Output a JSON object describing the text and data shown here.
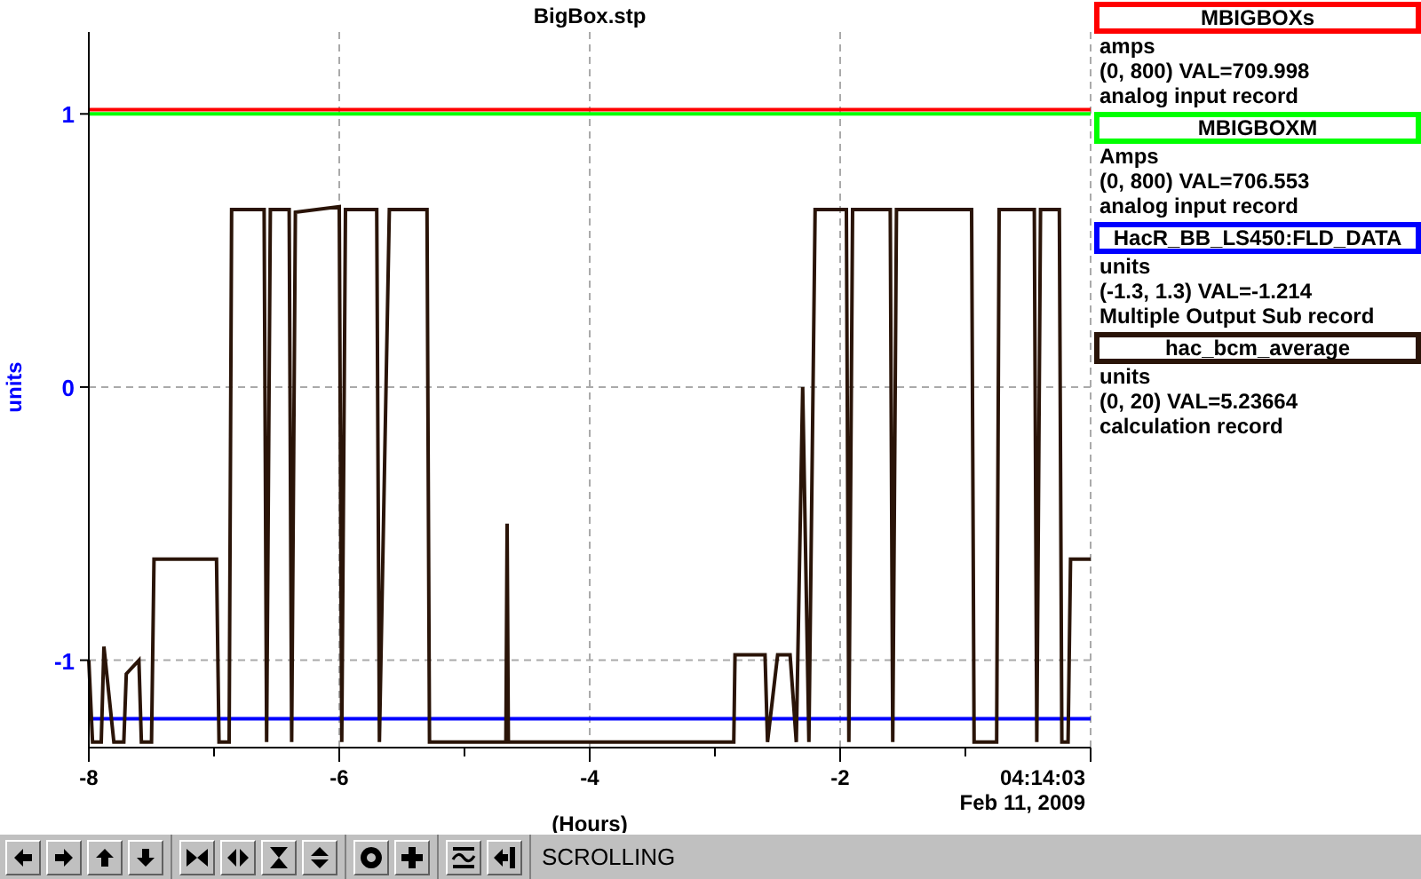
{
  "plot": {
    "time": "04:14:03",
    "date": "Feb 11, 2009",
    "chart_data": {
      "type": "line",
      "title": "BigBox.stp",
      "xlabel": "(Hours)",
      "ylabel": "units",
      "xlim": [
        -8,
        0
      ],
      "ylim": [
        -1.32,
        1.3
      ],
      "grid": true,
      "xticks": [
        -8,
        -6,
        -4,
        -2
      ],
      "yticks": [
        -1,
        0,
        1
      ],
      "x": [
        -8.0,
        -7.97,
        -7.9,
        -7.88,
        -7.8,
        -7.72,
        -7.7,
        -7.6,
        -7.58,
        -7.5,
        -7.48,
        -6.98,
        -6.96,
        -6.88,
        -6.86,
        -6.6,
        -6.58,
        -6.55,
        -6.4,
        -6.38,
        -6.35,
        -6.0,
        -5.98,
        -5.95,
        -5.7,
        -5.68,
        -5.6,
        -5.3,
        -5.28,
        -4.67,
        -4.66,
        -4.65,
        -2.85,
        -2.84,
        -2.6,
        -2.58,
        -2.5,
        -2.4,
        -2.35,
        -2.3,
        -2.25,
        -2.2,
        -1.95,
        -1.93,
        -1.9,
        -1.6,
        -1.58,
        -1.55,
        -0.95,
        -0.93,
        -0.75,
        -0.73,
        -0.45,
        -0.43,
        -0.4,
        -0.25,
        -0.23,
        -0.18,
        -0.16,
        0.0
      ],
      "series": [
        {
          "color": "#ff0000",
          "values": [
            1.015,
            1.015,
            1.015,
            1.015,
            1.015,
            1.015,
            1.015,
            1.015,
            1.015,
            1.015,
            1.015,
            1.015,
            1.015,
            1.015,
            1.015,
            1.015,
            1.015,
            1.015,
            1.015,
            1.015,
            1.015,
            1.015,
            1.015,
            1.015,
            1.015,
            1.015,
            1.015,
            1.015,
            1.015,
            1.015,
            1.015,
            1.015,
            1.015,
            1.015,
            1.015,
            1.015,
            1.015,
            1.015,
            1.015,
            1.015,
            1.015,
            1.015,
            1.015,
            1.015,
            1.015,
            1.015,
            1.015,
            1.015,
            1.015,
            1.015,
            1.015,
            1.015,
            1.015,
            1.015,
            1.015,
            1.015,
            1.015,
            1.015,
            1.015,
            1.015
          ]
        },
        {
          "color": "#00ff00",
          "values": [
            1.0,
            1.0,
            1.0,
            1.0,
            1.0,
            1.0,
            1.0,
            1.0,
            1.0,
            1.0,
            1.0,
            1.0,
            1.0,
            1.0,
            1.0,
            1.0,
            1.0,
            1.0,
            1.0,
            1.0,
            1.0,
            1.0,
            1.0,
            1.0,
            1.0,
            1.0,
            1.0,
            1.0,
            1.0,
            1.0,
            1.0,
            1.0,
            1.0,
            1.0,
            1.0,
            1.0,
            1.0,
            1.0,
            1.0,
            1.0,
            1.0,
            1.0,
            1.0,
            1.0,
            1.0,
            1.0,
            1.0,
            1.0,
            1.0,
            1.0,
            1.0,
            1.0,
            1.0,
            1.0,
            1.0,
            1.0,
            1.0,
            1.0,
            1.0,
            1.0
          ]
        },
        {
          "color": "#0000ff",
          "values": [
            -1.214,
            -1.214,
            -1.214,
            -1.214,
            -1.214,
            -1.214,
            -1.214,
            -1.214,
            -1.214,
            -1.214,
            -1.214,
            -1.214,
            -1.214,
            -1.214,
            -1.214,
            -1.214,
            -1.214,
            -1.214,
            -1.214,
            -1.214,
            -1.214,
            -1.214,
            -1.214,
            -1.214,
            -1.214,
            -1.214,
            -1.214,
            -1.214,
            -1.214,
            -1.214,
            -1.214,
            -1.214,
            -1.214,
            -1.214,
            -1.214,
            -1.214,
            -1.214,
            -1.214,
            -1.214,
            -1.214,
            -1.214,
            -1.214,
            -1.214,
            -1.214,
            -1.214,
            -1.214,
            -1.214,
            -1.214,
            -1.214,
            -1.214,
            -1.214,
            -1.214,
            -1.214,
            -1.214,
            -1.214,
            -1.214,
            -1.214,
            -1.214,
            -1.214,
            -1.214
          ]
        },
        {
          "color": "#2a1408",
          "values": [
            -1.0,
            -1.3,
            -1.3,
            -0.95,
            -1.3,
            -1.3,
            -1.05,
            -1.0,
            -1.3,
            -1.3,
            -0.63,
            -0.63,
            -1.3,
            -1.3,
            0.65,
            0.65,
            -1.3,
            0.65,
            0.65,
            -1.3,
            0.64,
            0.66,
            -1.3,
            0.65,
            0.65,
            -1.3,
            0.65,
            0.65,
            -1.3,
            -1.3,
            -0.5,
            -1.3,
            -1.3,
            -0.98,
            -0.98,
            -1.3,
            -0.98,
            -0.98,
            -1.3,
            0.0,
            -1.3,
            0.65,
            0.65,
            -1.3,
            0.65,
            0.65,
            -1.3,
            0.65,
            0.65,
            -1.3,
            -1.3,
            0.65,
            0.65,
            -1.3,
            0.65,
            0.65,
            -1.3,
            -1.3,
            -0.63,
            -0.63
          ]
        }
      ]
    }
  },
  "legend": [
    {
      "name": "MBIGBOXs",
      "color": "#ff0000",
      "units": "amps",
      "reading": "(0, 800)  VAL=709.998",
      "record": "analog input record"
    },
    {
      "name": "MBIGBOXM",
      "color": "#00ff00",
      "units": "Amps",
      "reading": "(0, 800) VAL=706.553",
      "record": "analog input record"
    },
    {
      "name": "HacR_BB_LS450:FLD_DATA",
      "color": "#0000ff",
      "units": "units",
      "reading": "(-1.3, 1.3) VAL=-1.214",
      "record": "Multiple Output Sub record"
    },
    {
      "name": "hac_bcm_average",
      "color": "#2a1408",
      "units": "units",
      "reading": "(0, 20) VAL=5.23664",
      "record": "calculation record"
    }
  ],
  "toolbar": {
    "groups": [
      {
        "buttons": [
          {
            "kind": "left"
          },
          {
            "kind": "right"
          },
          {
            "kind": "up"
          },
          {
            "kind": "down"
          }
        ]
      },
      {
        "buttons": [
          {
            "kind": "squeezex"
          },
          {
            "kind": "spreadx"
          },
          {
            "kind": "squeezey"
          },
          {
            "kind": "spready"
          }
        ]
      },
      {
        "buttons": [
          {
            "kind": "ring"
          },
          {
            "kind": "plus"
          }
        ]
      },
      {
        "buttons": [
          {
            "kind": "wave"
          },
          {
            "kind": "back"
          }
        ]
      }
    ],
    "status": "SCROLLING"
  }
}
